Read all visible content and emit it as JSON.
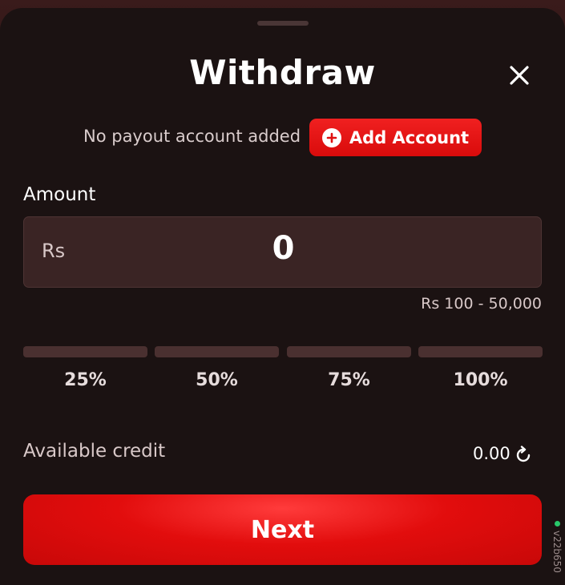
{
  "dialog": {
    "title": "Withdraw"
  },
  "payout": {
    "message": "No payout account added",
    "add_account_label": "Add Account"
  },
  "amount": {
    "label": "Amount",
    "currency": "Rs",
    "value": "0",
    "range": "Rs 100 - 50,000"
  },
  "presets": [
    {
      "label": "25%"
    },
    {
      "label": "50%"
    },
    {
      "label": "75%"
    },
    {
      "label": "100%"
    }
  ],
  "credit": {
    "label": "Available credit",
    "value": "0.00"
  },
  "actions": {
    "next_label": "Next"
  },
  "version": {
    "text": "v22b650"
  },
  "icons": {
    "close": "close-icon",
    "add": "plus-circle-icon",
    "refresh": "refresh-icon"
  },
  "colors": {
    "accent": "#e20d0d",
    "sheet": "#1b1212",
    "field": "#3a2424",
    "bar": "#4a3030"
  }
}
